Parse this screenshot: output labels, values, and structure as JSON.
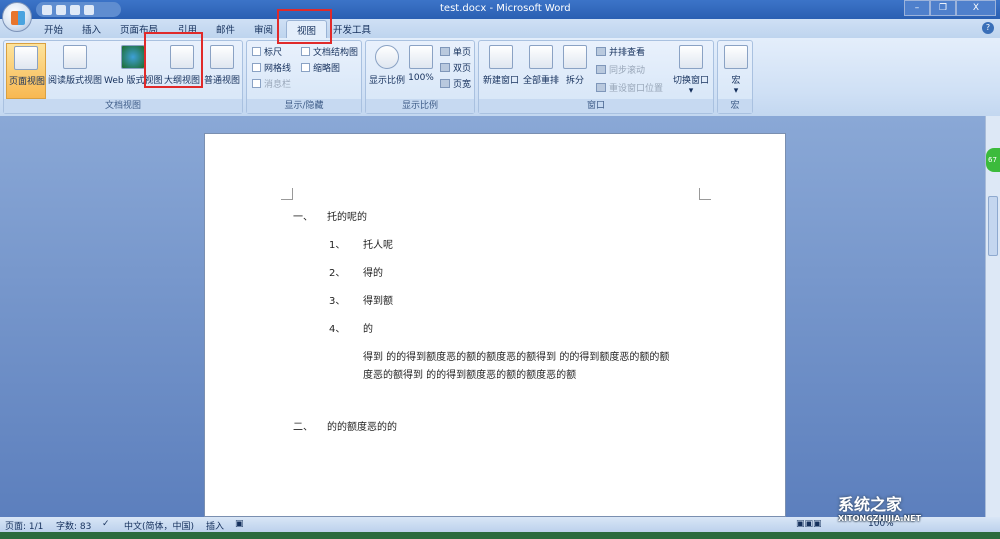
{
  "window": {
    "title": "test.docx - Microsoft Word",
    "minimize": "–",
    "restore": "❐",
    "close": "X"
  },
  "tabs": [
    "开始",
    "插入",
    "页面布局",
    "引用",
    "邮件",
    "审阅",
    "视图",
    "开发工具"
  ],
  "active_tab": "视图",
  "ribbon": {
    "doc_views": {
      "label": "文档视图",
      "items": [
        "页面视图",
        "阅读版式视图",
        "Web 版式视图",
        "大纲视图",
        "普通视图"
      ],
      "selected": "页面视图",
      "highlighted": "大纲视图"
    },
    "show_hide": {
      "label": "显示/隐藏",
      "items": [
        {
          "label": "标尺",
          "checked": false
        },
        {
          "label": "文档结构图",
          "checked": false
        },
        {
          "label": "网格线",
          "checked": false
        },
        {
          "label": "缩略图",
          "checked": false
        },
        {
          "label": "消息栏",
          "checked": false,
          "disabled": true
        }
      ]
    },
    "zoom": {
      "label": "显示比例",
      "items": [
        "显示比例",
        "100%"
      ],
      "small": [
        "单页",
        "双页",
        "页宽"
      ]
    },
    "window": {
      "label": "窗口",
      "items": [
        "新建窗口",
        "全部重排",
        "拆分"
      ],
      "small": [
        "并排查看",
        "同步滚动",
        "重设窗口位置"
      ],
      "switch": "切换窗口"
    },
    "macro": {
      "label": "宏",
      "item": "宏"
    }
  },
  "document": {
    "lines": [
      {
        "num": "一、",
        "text": "托的呢的"
      },
      {
        "num": "1、",
        "text": "托人呢"
      },
      {
        "num": "2、",
        "text": "得的"
      },
      {
        "num": "3、",
        "text": "得到额"
      },
      {
        "num": "4、",
        "text": "的"
      },
      {
        "num": "",
        "text": "得到 的的得到额度恶的额的额度恶的额得到 的的得到额度恶的额的额"
      },
      {
        "num": "",
        "text": "度恶的额得到 的的得到额度恶的额的额度恶的额"
      },
      {
        "num": "二、",
        "text": "的的额度恶的的"
      }
    ]
  },
  "statusbar": {
    "page": "页面: 1/1",
    "words": "字数: 83",
    "language": "中文(简体，中国)",
    "mode": "插入",
    "zoom": "100%"
  },
  "zoom_badge": "67",
  "watermark": {
    "name": "系统之家",
    "url": "XITONGZHIJIA.NET"
  }
}
